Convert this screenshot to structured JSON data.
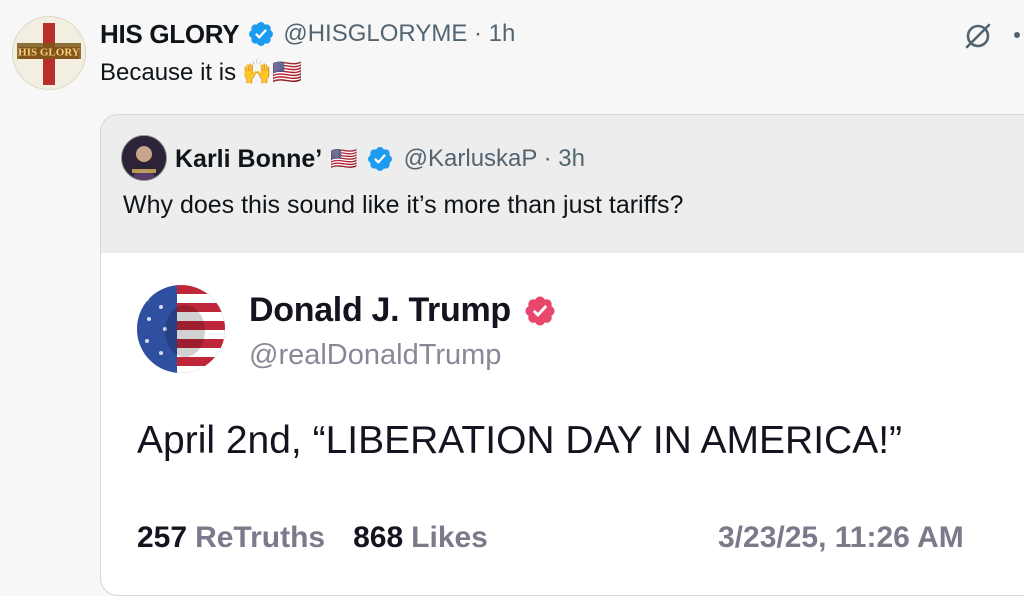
{
  "tweet": {
    "author_name": "HIS GLORY",
    "handle_meta": "@HISGLORYME · 1h",
    "text": "Because it is",
    "emojis": "🙌🇺🇸",
    "avatar_logo_text": "HIS GLORY",
    "verified_color": "#1d9bf0"
  },
  "quote": {
    "author_name": "Karli Bonne’",
    "flag": "🇺🇸",
    "handle_meta": "@KarluskaP · 3h",
    "text": "Why does this sound like it’s more than just tariffs?"
  },
  "embed": {
    "name": "Donald J. Trump",
    "handle": "@realDonaldTrump",
    "body": "April 2nd, “LIBERATION DAY IN AMERICA!”",
    "retruths_count": "257",
    "retruths_label": "ReTruths",
    "likes_count": "868",
    "likes_label": "Likes",
    "timestamp": "3/23/25, 11:26 AM",
    "badge_color": "#e8466b"
  }
}
